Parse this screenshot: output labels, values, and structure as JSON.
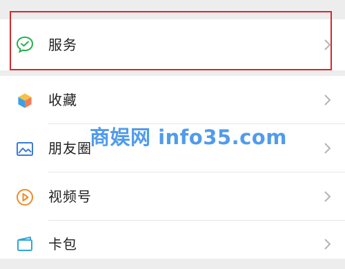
{
  "menu": {
    "items": [
      {
        "label": "服务",
        "icon": "chat-check-icon",
        "color": "#22b14c"
      },
      {
        "label": "收藏",
        "icon": "cube-icon",
        "color": "#f4a634"
      },
      {
        "label": "朋友圈",
        "icon": "image-icon",
        "color": "#3a7bd5"
      },
      {
        "label": "视频号",
        "icon": "play-circle-icon",
        "color": "#f08a24"
      },
      {
        "label": "卡包",
        "icon": "card-icon",
        "color": "#2ea6d6"
      }
    ]
  },
  "watermark": {
    "text": "商娱网 info35.com"
  },
  "colors": {
    "highlight": "#d7262b",
    "background": "#ededed"
  }
}
